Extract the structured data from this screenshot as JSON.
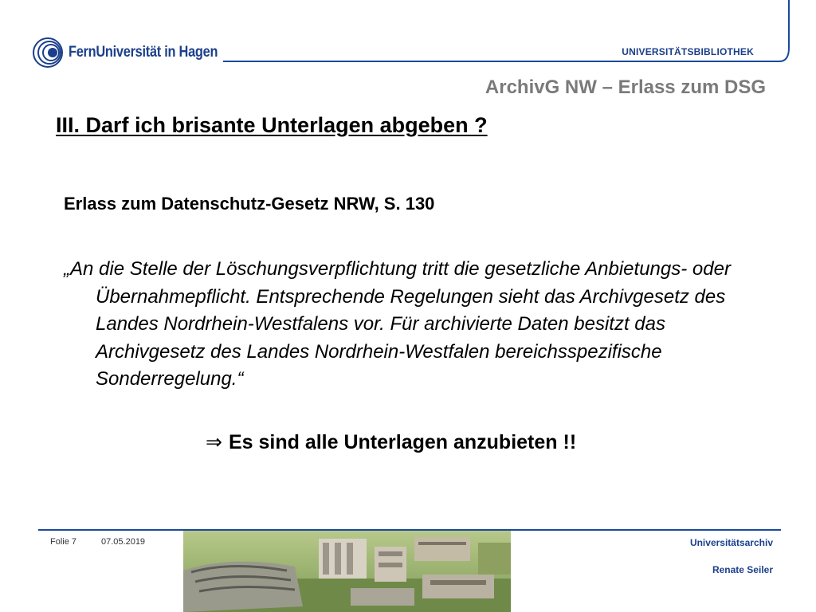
{
  "header": {
    "logo_text": "FernUniversität in Hagen",
    "library_label": "UNIVERSITÄTSBIBLIOTHEK",
    "topic": "ArchivG NW – Erlass zum DSG"
  },
  "slide": {
    "heading": "III. Darf ich brisante Unterlagen abgeben ?",
    "source": "Erlass zum Datenschutz-Gesetz NRW, S. 130",
    "quote": "„An die Stelle der Löschungsverpflichtung tritt die gesetzliche Anbietungs- oder Übernahmepflicht. Entsprechende Regelungen sieht das Archivgesetz des Landes Nordrhein-Westfalens vor. Für archivierte Daten besitzt das Archivgesetz des Landes Nordrhein-Westfalen bereichsspezifische Sonderregelung.“",
    "conclusion_arrow": "⇒",
    "conclusion": "Es sind alle Unterlagen anzubieten !!"
  },
  "footer": {
    "slide_label": "Folie 7",
    "date": "07.05.2019",
    "department": "Universitätsarchiv",
    "author": "Renate Seiler"
  },
  "colors": {
    "brand_blue": "#1b3f8b",
    "topic_gray": "#7a7a7a"
  }
}
